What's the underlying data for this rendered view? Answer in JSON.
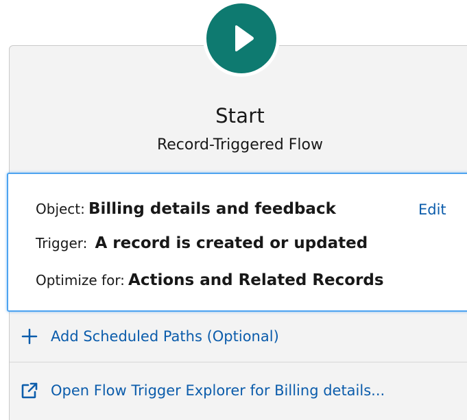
{
  "start_node": {
    "title": "Start",
    "subtitle": "Record-Triggered Flow",
    "play_icon": "play-icon"
  },
  "details": {
    "object_label": "Object:",
    "object_value": "Billing details and feedback",
    "trigger_label": "Trigger:",
    "trigger_value": "A record is created or updated",
    "optimize_label": "Optimize for:",
    "optimize_value": "Actions and Related Records",
    "edit_label": "Edit"
  },
  "actions": {
    "scheduled_paths_label": "Add Scheduled Paths (Optional)",
    "scheduled_paths_icon": "plus-icon",
    "explorer_label": "Open Flow Trigger Explorer for Billing details...",
    "explorer_icon": "external-link-icon"
  },
  "colors": {
    "accent_teal": "#0e7a70",
    "link_blue": "#0b5cab",
    "selection_border": "#4da3f0",
    "card_background": "#f3f3f3"
  }
}
